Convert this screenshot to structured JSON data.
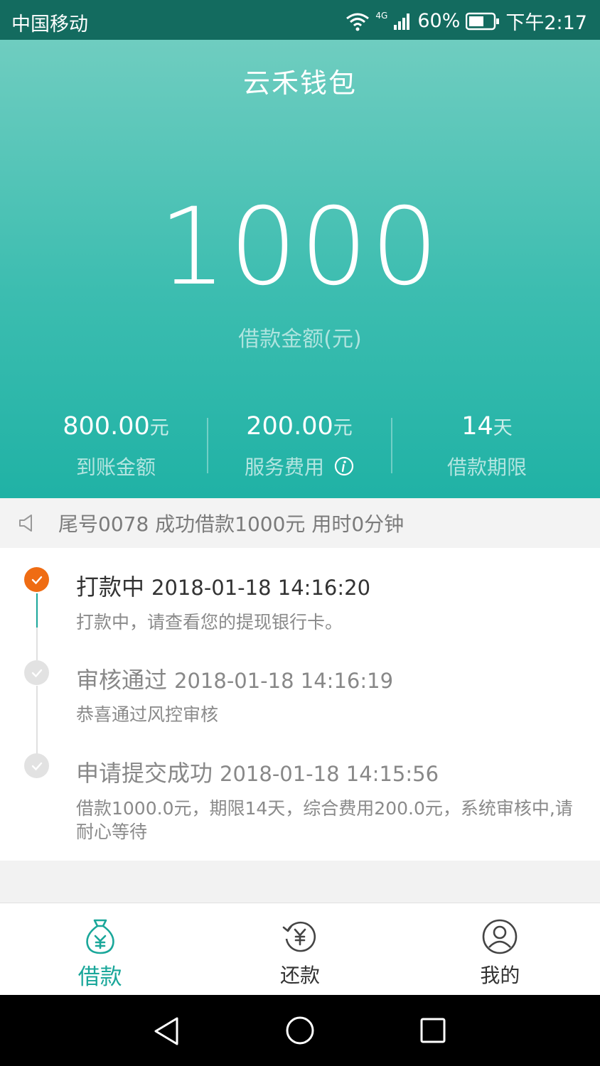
{
  "status_bar": {
    "carrier": "中国移动",
    "network": "4G",
    "battery": "60%",
    "time": "下午2:17"
  },
  "hero": {
    "title": "云禾钱包",
    "amount": "1000",
    "amount_label": "借款金额(元)",
    "stats": [
      {
        "value": "800.00",
        "unit": "元",
        "label": "到账金额"
      },
      {
        "value": "200.00",
        "unit": "元",
        "label": "服务费用"
      },
      {
        "value": "14",
        "unit": "天",
        "label": "借款期限"
      }
    ]
  },
  "notice": {
    "text": "尾号0078 成功借款1000元 用时0分钟"
  },
  "timeline": [
    {
      "title": "打款中",
      "time": "2018-01-18 14:16:20",
      "desc": "打款中，请查看您的提现银行卡。"
    },
    {
      "title": "审核通过",
      "time": "2018-01-18 14:16:19",
      "desc": "恭喜通过风控审核"
    },
    {
      "title": "申请提交成功",
      "time": "2018-01-18 14:15:56",
      "desc": "借款1000.0元，期限14天，综合费用200.0元，系统审核中,请耐心等待"
    }
  ],
  "tabs": [
    {
      "label": "借款",
      "icon": "money-bag-icon"
    },
    {
      "label": "还款",
      "icon": "repay-icon"
    },
    {
      "label": "我的",
      "icon": "user-icon"
    }
  ],
  "colors": {
    "accent": "#1aa79a",
    "active_step": "#ef6c13",
    "status_bar": "#136b5f"
  }
}
